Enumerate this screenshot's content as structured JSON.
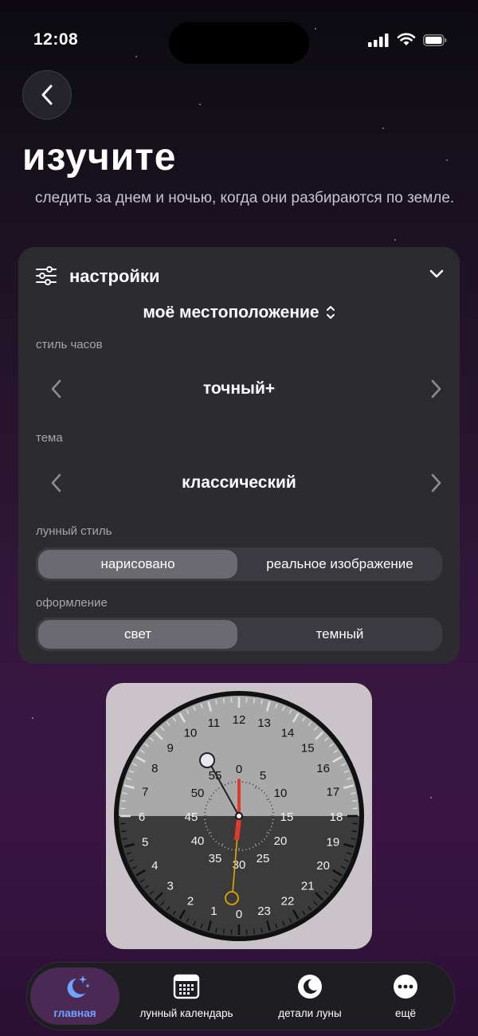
{
  "status_bar": {
    "time": "12:08"
  },
  "header": {
    "title": "изучите",
    "description": "следить за днем и ночью, когда они разбираются по земле."
  },
  "settings": {
    "title": "настройки",
    "location": "моё местоположение",
    "clock_style": {
      "label": "стиль часов",
      "value": "точный+"
    },
    "theme": {
      "label": "тема",
      "value": "классический"
    },
    "moon_style": {
      "label": "лунный стиль",
      "options": [
        "нарисовано",
        "реальное изображение"
      ],
      "selected": "нарисовано"
    },
    "appearance": {
      "label": "оформление",
      "options": [
        "свет",
        "темный"
      ],
      "selected": "свет"
    }
  },
  "clock": {
    "hour_labels": [
      "0",
      "1",
      "2",
      "3",
      "4",
      "5",
      "6",
      "7",
      "8",
      "9",
      "10",
      "11",
      "12",
      "13",
      "14",
      "15",
      "16",
      "17",
      "18",
      "19",
      "20",
      "21",
      "22",
      "23"
    ],
    "minute_labels": [
      "0",
      "5",
      "10",
      "15",
      "20",
      "25",
      "30",
      "35",
      "40",
      "45",
      "50",
      "55"
    ],
    "colors": {
      "day_face": "#a9a9a9",
      "night_face": "#3b3b3b",
      "second_hand": "#e03a2f",
      "sun_hand": "#e0a800",
      "moon_marker": "#e8e8f2",
      "card": "#cac4ca"
    }
  },
  "tabbar": {
    "items": [
      {
        "label": "главная",
        "icon": "moon-stars-icon",
        "active": true
      },
      {
        "label": "лунный календарь",
        "icon": "calendar-icon",
        "active": false
      },
      {
        "label": "детали луны",
        "icon": "moon-icon",
        "active": false
      },
      {
        "label": "ещё",
        "icon": "more-icon",
        "active": false
      }
    ]
  }
}
